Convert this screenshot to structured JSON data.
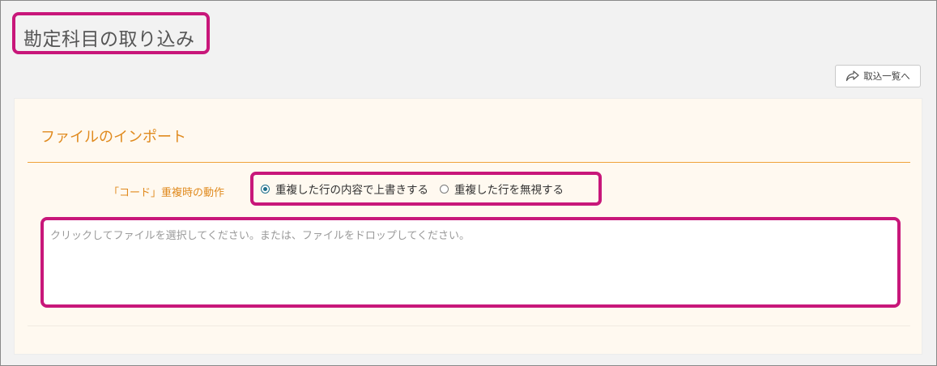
{
  "page": {
    "title": "勘定科目の取り込み"
  },
  "toolbar": {
    "import_list_label": "取込一覧へ",
    "import_list_icon": "share-arrow-icon"
  },
  "import_panel": {
    "heading": "ファイルのインポート",
    "duplicate_setting": {
      "label": "「コード」重複時の動作",
      "options": [
        {
          "label": "重複した行の内容で上書きする",
          "selected": true
        },
        {
          "label": "重複した行を無視する",
          "selected": false
        }
      ]
    },
    "file_drop": {
      "placeholder": "クリックしてファイルを選択してください。または、ファイルをドロップしてください。"
    }
  },
  "colors": {
    "accent_orange": "#e08a1e",
    "highlight_magenta": "#c8177a",
    "radio_selected": "#1f6f8b",
    "panel_background": "#fff9f0"
  }
}
